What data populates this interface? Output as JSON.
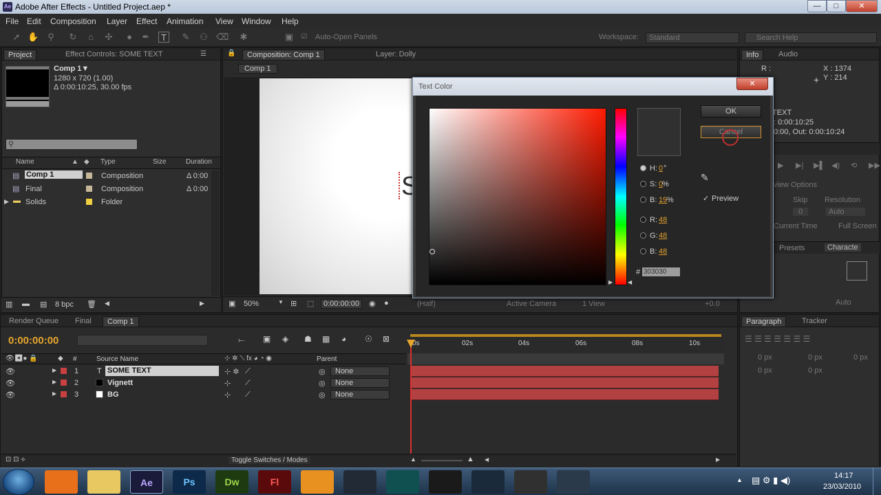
{
  "window": {
    "title": "Adobe After Effects - Untitled Project.aep *",
    "min": "—",
    "max": "□",
    "close": "✕"
  },
  "menu": [
    "File",
    "Edit",
    "Composition",
    "Layer",
    "Effect",
    "Animation",
    "View",
    "Window",
    "Help"
  ],
  "toolbar": {
    "auto_open": "Auto-Open Panels",
    "workspace_label": "Workspace:",
    "workspace_value": "Standard",
    "search_placeholder": "Search Help"
  },
  "project_panel": {
    "tab_project": "Project",
    "tab_effects": "Effect Controls: SOME TEXT",
    "selected_name": "Comp 1▼",
    "selected_size": "1280 x 720 (1.00)",
    "selected_duration": "Δ 0:00:10:25, 30.00 fps",
    "columns": {
      "name": "Name",
      "type": "Type",
      "size": "Size",
      "duration": "Duration"
    },
    "items": [
      {
        "name": "Comp 1",
        "type": "Composition",
        "duration": "Δ 0:00",
        "color": "#c8b89a"
      },
      {
        "name": "Final",
        "type": "Composition",
        "duration": "Δ 0:00",
        "color": "#c8b89a"
      },
      {
        "name": "Solids",
        "type": "Folder",
        "duration": "",
        "color": "#f0d040"
      }
    ],
    "bpc": "8 bpc"
  },
  "comp_panel": {
    "tab_comp": "Composition: Comp 1",
    "tab_layer": "Layer: Dolly",
    "breadcrumb": "Comp 1",
    "canvas_text": "S",
    "zoom": "50%",
    "timecode": "0:00:00:00",
    "resolution": "(Half)",
    "camera": "Active Camera",
    "views": "1 View",
    "exposure": "+0.0"
  },
  "dialog": {
    "title": "Text Color",
    "close": "✕",
    "ok": "OK",
    "cancel": "Cancel",
    "h_label": "H:",
    "h_value": "0",
    "h_unit": "°",
    "s_label": "S:",
    "s_value": "0",
    "s_unit": " %",
    "b_label": "B:",
    "b_value": "19",
    "b_unit": " %",
    "r_label": "R:",
    "r_value": "48",
    "g_label": "G:",
    "g_value": "48",
    "bb_label": "B:",
    "bb_value": "48",
    "hash": "#",
    "hex": "303030",
    "preview_label": "Preview",
    "check": "✓",
    "color_value": "#303030"
  },
  "info_panel": {
    "tab_info": "Info",
    "tab_audio": "Audio",
    "r_label": "R :",
    "x": "X : 1374",
    "y": "Y : 214",
    "text_label": "TEXT",
    "time1": ": 0:00:10:25",
    "time2": "0:00, Out: 0:00:10:24",
    "view_options": "view Options",
    "skip_label": "Skip",
    "res_label": "Resolution",
    "skip_value": "0",
    "res_value": "Auto",
    "current_time": "Current Time",
    "full_screen": "Full Screen",
    "presets": "Presets",
    "character": "Characte",
    "auto": "Auto"
  },
  "timeline": {
    "tab_render": "Render Queue",
    "tab_final": "Final",
    "tab_comp": "Comp 1",
    "timecode": "0:00:00:00",
    "col_source": "Source Name",
    "col_parent": "Parent",
    "layers": [
      {
        "num": "1",
        "name": "SOME TEXT",
        "parent": "None",
        "label_color": "#c84040",
        "swatch": ""
      },
      {
        "num": "2",
        "name": "Vignett",
        "parent": "None",
        "label_color": "#c84040",
        "swatch": "#000000"
      },
      {
        "num": "3",
        "name": "BG",
        "parent": "None",
        "label_color": "#c84040",
        "swatch": "#ffffff"
      }
    ],
    "ruler": [
      "0s",
      "02s",
      "04s",
      "06s",
      "08s",
      "10s"
    ],
    "toggle_label": "Toggle Switches / Modes"
  },
  "paragraph_panel": {
    "tab_paragraph": "Paragraph",
    "tab_tracker": "Tracker",
    "px1": "0 px",
    "px2": "0 px",
    "px3": "0 px",
    "px4": "0 px",
    "px5": "0 px"
  },
  "taskbar": {
    "apps": [
      {
        "id": "firefox",
        "label": "",
        "color": "#e8701a"
      },
      {
        "id": "explorer",
        "label": "",
        "color": "#e8c860"
      },
      {
        "id": "aftereffects",
        "label": "Ae",
        "color": "#1a1a3a"
      },
      {
        "id": "photoshop",
        "label": "Ps",
        "color": "#0d2a4a"
      },
      {
        "id": "dreamweaver",
        "label": "Dw",
        "color": "#1d3a10"
      },
      {
        "id": "flash",
        "label": "Fl",
        "color": "#5a0a0a"
      },
      {
        "id": "app7",
        "label": "",
        "color": "#e89020"
      },
      {
        "id": "app8",
        "label": "",
        "color": "#222a36"
      },
      {
        "id": "app9",
        "label": "",
        "color": "#105050"
      },
      {
        "id": "app10",
        "label": "",
        "color": "#1a1a1a"
      },
      {
        "id": "steam",
        "label": "",
        "color": "#1a2a3a"
      },
      {
        "id": "app12",
        "label": "",
        "color": "#303030"
      },
      {
        "id": "app13",
        "label": "",
        "color": "#2a3a4a"
      }
    ],
    "time": "14:17",
    "date": "23/03/2010"
  }
}
